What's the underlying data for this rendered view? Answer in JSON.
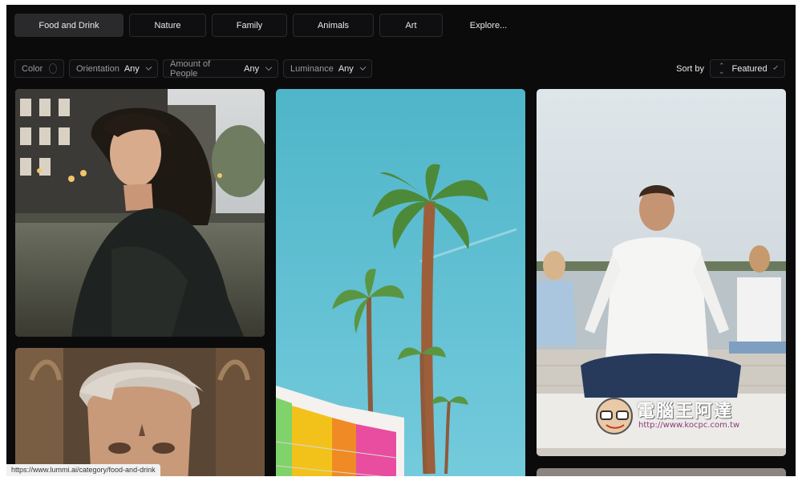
{
  "tabs": [
    {
      "label": "Food and Drink",
      "active": true
    },
    {
      "label": "Nature"
    },
    {
      "label": "Family"
    },
    {
      "label": "Animals"
    },
    {
      "label": "Art"
    },
    {
      "label": "Explore..."
    }
  ],
  "filters": {
    "color": {
      "label": "Color"
    },
    "orientation": {
      "label": "Orientation",
      "value": "Any"
    },
    "people": {
      "label": "Amount of People",
      "value": "Any"
    },
    "luminance": {
      "label": "Luminance",
      "value": "Any"
    }
  },
  "sort": {
    "label": "Sort by",
    "value": "Featured"
  },
  "status_url": "https://www.lummi.ai/category/food-and-drink",
  "watermark": {
    "title": "電腦王阿達",
    "url": "http://www.kocpc.com.tw"
  },
  "colors": {
    "background": "#0b0b0c",
    "tab_active": "#2a2a2d",
    "border": "#2b2b2e",
    "sky": "#5ec3d6"
  }
}
